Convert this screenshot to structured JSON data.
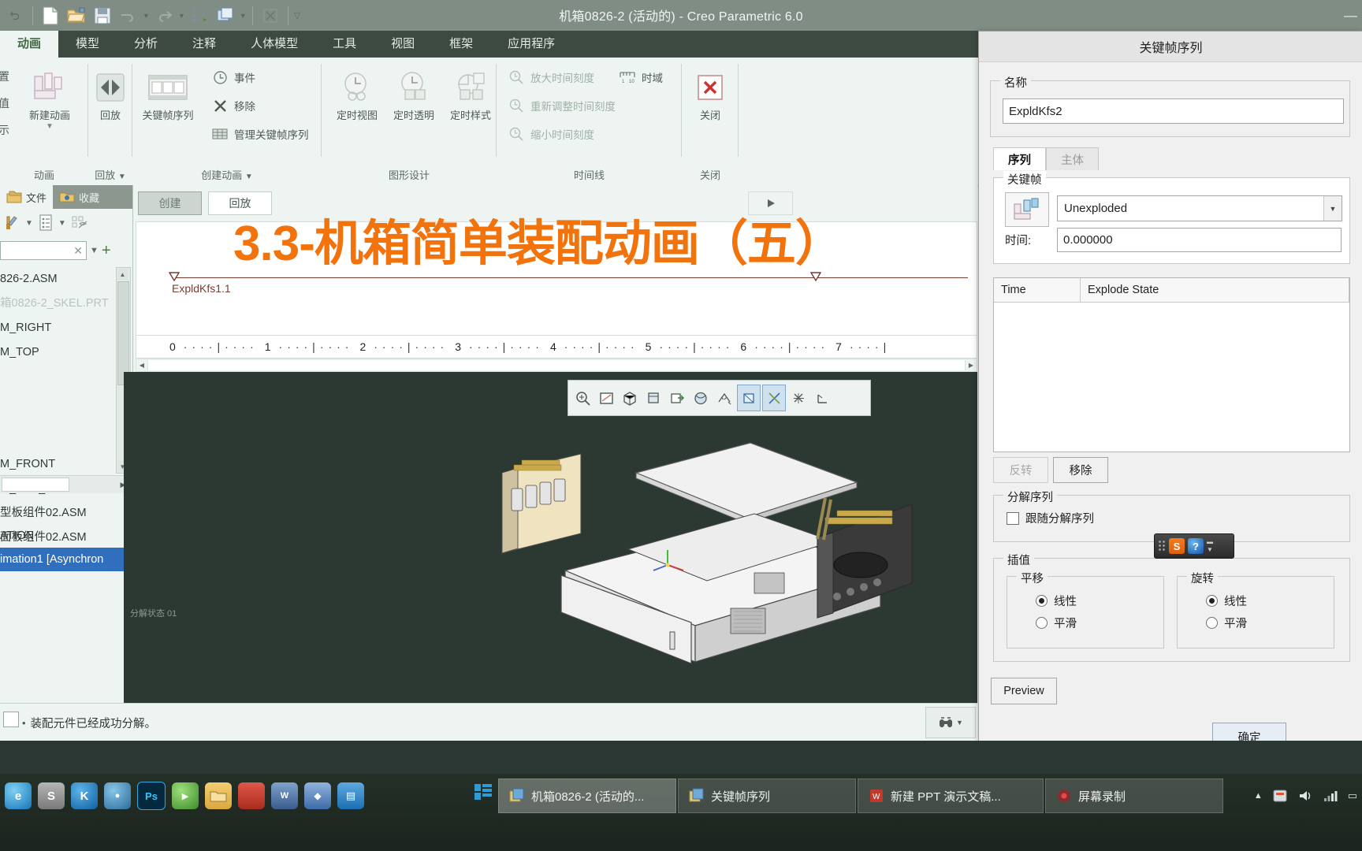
{
  "window": {
    "title": "机箱0826-2 (活动的) - Creo Parametric 6.0",
    "minimize": "—"
  },
  "quick_access": {
    "items": [
      {
        "name": "new-file-icon",
        "label": "新建"
      },
      {
        "name": "open-file-icon",
        "label": "打开"
      },
      {
        "name": "save-icon",
        "label": "保存"
      },
      {
        "name": "undo-icon",
        "label": "撤消"
      },
      {
        "name": "redo-icon",
        "label": "重做"
      },
      {
        "name": "regenerate-icon",
        "label": "重新生成"
      },
      {
        "name": "window-switch-icon",
        "label": "窗口"
      },
      {
        "name": "close-window-icon",
        "label": "关闭窗口"
      }
    ]
  },
  "ribbon": {
    "tabs": [
      {
        "label": "动画",
        "active": true
      },
      {
        "label": "模型",
        "active": false
      },
      {
        "label": "分析",
        "active": false
      },
      {
        "label": "注释",
        "active": false
      },
      {
        "label": "人体模型",
        "active": false
      },
      {
        "label": "工具",
        "active": false
      },
      {
        "label": "视图",
        "active": false
      },
      {
        "label": "框架",
        "active": false
      },
      {
        "label": "应用程序",
        "active": false
      }
    ],
    "groups": [
      {
        "name": "动画",
        "label": "动画",
        "clipped_labels": [
          "置",
          "值",
          "示"
        ],
        "big_buttons": [
          {
            "label": "新建动画",
            "icon": "new-animation-icon",
            "has_dropdown": true
          }
        ]
      },
      {
        "name": "playback",
        "label": "回放",
        "has_dropdown": true,
        "big_buttons": [
          {
            "label": "回放",
            "icon": "playback-icon"
          }
        ]
      },
      {
        "name": "create-animation",
        "label": "创建动画",
        "has_dropdown": true,
        "big_buttons": [
          {
            "label": "关键帧序列",
            "icon": "keyframe-sequence-icon"
          }
        ],
        "small_buttons": [
          {
            "label": "事件",
            "icon": "event-clock-icon"
          },
          {
            "label": "移除",
            "icon": "remove-x-icon"
          },
          {
            "label": "管理关键帧序列",
            "icon": "manage-keyframe-icon"
          }
        ]
      },
      {
        "name": "graphic-design",
        "label": "图形设计",
        "big_buttons": [
          {
            "label": "定时视图",
            "icon": "timed-view-icon"
          },
          {
            "label": "定时透明",
            "icon": "timed-transparency-icon"
          },
          {
            "label": "定时样式",
            "icon": "timed-style-icon"
          }
        ]
      },
      {
        "name": "timeline",
        "label": "时间线",
        "small_buttons": [
          {
            "label": "放大时间刻度",
            "icon": "zoom-in-timescale-icon",
            "disabled": true
          },
          {
            "label": "重新调整时间刻度",
            "icon": "refit-timescale-icon",
            "disabled": true
          },
          {
            "label": "缩小时间刻度",
            "icon": "zoom-out-timescale-icon",
            "disabled": true
          },
          {
            "label": "时域",
            "icon": "time-domain-icon",
            "disabled": false
          }
        ]
      },
      {
        "name": "close",
        "label": "关闭",
        "big_buttons": [
          {
            "label": "关闭",
            "icon": "close-red-x-icon"
          }
        ]
      }
    ]
  },
  "navigator": {
    "tabs": [
      {
        "label": "文件",
        "icon": "model-tree-icon",
        "selected": true
      },
      {
        "label": "收藏",
        "icon": "favorites-folder-icon",
        "selected": false
      }
    ],
    "toolbar_icons": [
      "settings-tools-icon",
      "tree-filters-icon",
      "tree-columns-icon"
    ],
    "search": {
      "value": "",
      "clear_icon": "clear-x-icon",
      "dropdown_icon": "chevron-down-icon",
      "add_icon": "plus-icon"
    },
    "tree_items": [
      {
        "label": "826-2.ASM",
        "ghost": false
      },
      {
        "label": "箱0826-2_SKEL.PRT",
        "ghost": true
      },
      {
        "label": "M_RIGHT",
        "ghost": false
      },
      {
        "label": "M_TOP",
        "ghost": false
      },
      {
        "label": "M_FRONT",
        "ghost": false
      },
      {
        "label": "M_DEF_CSYS",
        "ghost": false
      },
      {
        "label": "型板组件02.ASM",
        "ghost": false
      },
      {
        "label": "面板组件02.ASM",
        "ghost": false
      }
    ],
    "anim_items": [
      {
        "label": "ATION",
        "selected": false
      },
      {
        "label": "imation1 [Asynchron",
        "selected": true
      }
    ]
  },
  "timeline": {
    "buttons": [
      {
        "label": "创建",
        "style": "gray"
      },
      {
        "label": "回放",
        "style": "white"
      }
    ],
    "play_icon": "play-triangle-icon",
    "keyframe_label": "ExpldKfs1.1",
    "ruler_ticks": [
      "0",
      "1",
      "2",
      "3",
      "4",
      "5",
      "6",
      "7"
    ]
  },
  "graphics": {
    "toolbar_icons": [
      {
        "name": "zoom-box-icon",
        "selected": false
      },
      {
        "name": "refit-icon",
        "selected": false
      },
      {
        "name": "orient-icon",
        "selected": false
      },
      {
        "name": "saved-views-icon",
        "selected": false
      },
      {
        "name": "view-manager-icon",
        "selected": false
      },
      {
        "name": "display-style-icon",
        "selected": false
      },
      {
        "name": "datum-display-icon",
        "selected": false
      },
      {
        "name": "plane-display-icon",
        "selected": true
      },
      {
        "name": "axis-display-icon",
        "selected": true
      },
      {
        "name": "point-display-icon",
        "selected": false
      },
      {
        "name": "csys-display-icon",
        "selected": false
      }
    ],
    "explode_label": "分解状态 01"
  },
  "statusbar": {
    "message": "装配元件已经成功分解。",
    "bullet": "•",
    "search_icon": "binoculars-icon",
    "dropdown_icon": "chevron-down-icon",
    "checkbox_checked": false
  },
  "overlay_title": "3.3-机箱简单装配动画（五）",
  "dialog": {
    "title": "关键帧序列",
    "name_group": {
      "legend": "名称",
      "value": "ExpldKfs2"
    },
    "tabs": [
      {
        "label": "序列",
        "active": true
      },
      {
        "label": "主体",
        "active": false
      }
    ],
    "keyframe_group": {
      "legend": "关键帧",
      "preview_icon": "keyframe-preview-icon",
      "state_value": "Unexploded",
      "state_dropdown_icon": "chevron-down-icon",
      "time_label": "时间:",
      "time_value": "0.000000"
    },
    "grid": {
      "columns": [
        "Time",
        "Explode State"
      ],
      "rows": []
    },
    "grid_buttons": [
      {
        "label": "反转",
        "disabled": true
      },
      {
        "label": "移除",
        "disabled": false
      }
    ],
    "explode_group": {
      "legend": "分解序列",
      "checkbox_label": "跟随分解序列",
      "checked": false
    },
    "interp_group": {
      "legend": "插值",
      "subgroups": [
        {
          "legend": "平移",
          "options": [
            {
              "label": "线性",
              "selected": true
            },
            {
              "label": "平滑",
              "selected": false
            }
          ]
        },
        {
          "legend": "旋转",
          "options": [
            {
              "label": "线性",
              "selected": true
            },
            {
              "label": "平滑",
              "selected": false
            }
          ]
        }
      ]
    },
    "preview_button": "Preview",
    "ok_button": "确定"
  },
  "ime": {
    "logo": "S",
    "help_icon": "question-icon",
    "minimize_icon": "minimize-icon",
    "menu_icon": "chevron-down-icon"
  },
  "taskbar": {
    "quick_launch": [
      {
        "name": "ie-browser-icon",
        "color": "#2196c9",
        "glyph": "e"
      },
      {
        "name": "sogou-browser-icon",
        "color": "#9a9a9a",
        "glyph": "S"
      },
      {
        "name": "kugou-icon",
        "color": "#1779c4",
        "glyph": "K"
      },
      {
        "name": "game-icon",
        "color": "#5fa4d0",
        "glyph": "●"
      },
      {
        "name": "photoshop-icon",
        "color": "#0b3d5c",
        "glyph": "Ps"
      },
      {
        "name": "media-icon",
        "color": "#7fc242",
        "glyph": "▶"
      },
      {
        "name": "folder-icon",
        "color": "#e8b44a",
        "glyph": ""
      },
      {
        "name": "wps-writer-icon",
        "color": "#c0392b",
        "glyph": "W"
      },
      {
        "name": "creo-icon",
        "color": "#4a72a8",
        "glyph": "◆"
      },
      {
        "name": "calculator-icon",
        "color": "#4d7cb5",
        "glyph": "▤"
      },
      {
        "name": "tasks-icon",
        "color": "#2e86c1",
        "glyph": "≡"
      }
    ],
    "start_icon": "start-grid-icon",
    "windows": [
      {
        "label": "机箱0826-2 (活动的...",
        "icon": "creo-window-icon",
        "active": true
      },
      {
        "label": "关键帧序列",
        "icon": "creo-window-icon",
        "active": false
      },
      {
        "label": "新建 PPT 演示文稿...",
        "icon": "wps-ppt-icon",
        "active": false
      },
      {
        "label": "屏幕录制",
        "icon": "record-icon",
        "active": false
      }
    ],
    "tray": [
      {
        "name": "tray-expand-icon",
        "glyph": "▲"
      },
      {
        "name": "tray-app-icon",
        "glyph": "■"
      },
      {
        "name": "volume-icon",
        "glyph": "◂"
      },
      {
        "name": "network-icon",
        "glyph": "◢"
      },
      {
        "name": "tray-extra-icon",
        "glyph": "▭"
      }
    ]
  }
}
